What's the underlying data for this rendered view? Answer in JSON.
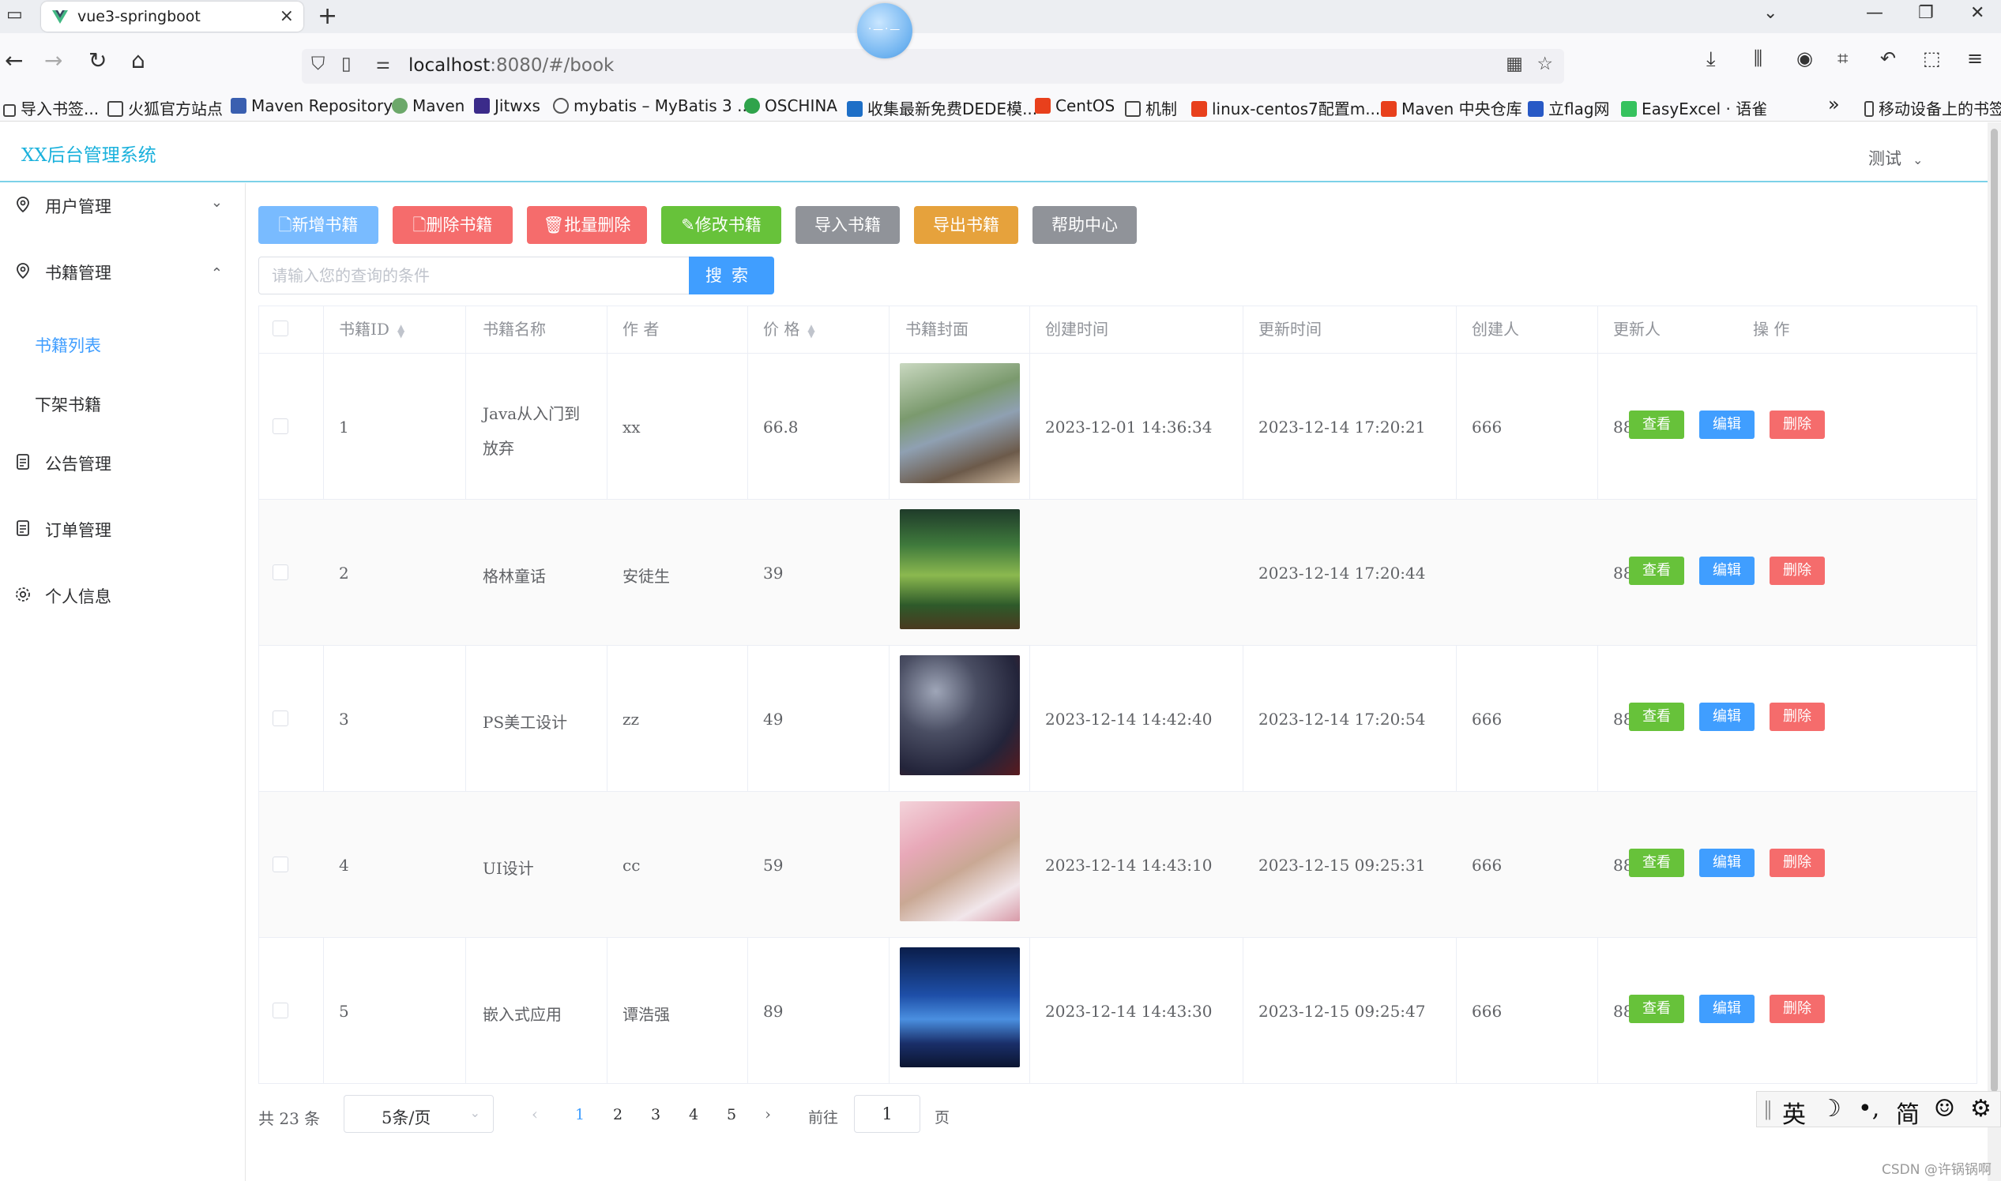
{
  "browser": {
    "tab_title": "vue3-springboot",
    "url_host": "localhost",
    "url_rest": ":8080/#/book",
    "bookmarks": [
      "导入书签...",
      "火狐官方站点",
      "Maven Repository",
      "Maven",
      "Jitwxs",
      "mybatis – MyBatis 3 ...",
      "OSCHINA",
      "收集最新免费DEDE模...",
      "CentOS",
      "机制",
      "linux-centos7配置m...",
      "Maven 中央仓库",
      "立flag网",
      "EasyExcel · 语雀"
    ],
    "bookmarks_overflow": "»",
    "mobile_bookmarks": "移动设备上的书签"
  },
  "app": {
    "brand": "XX后台管理系统",
    "user_menu": "测试",
    "sidebar": {
      "user_mgmt": "用户管理",
      "book_mgmt": "书籍管理",
      "book_list": "书籍列表",
      "book_offshelf": "下架书籍",
      "notice_mgmt": "公告管理",
      "order_mgmt": "订单管理",
      "profile": "个人信息"
    },
    "toolbar": {
      "add": "新增书籍",
      "delete": "删除书籍",
      "batch_delete": "批量删除",
      "edit": "修改书籍",
      "import": "导入书籍",
      "export": "导出书籍",
      "help": "帮助中心"
    },
    "search": {
      "placeholder": "请输入您的查询的条件",
      "button": "搜索"
    },
    "table": {
      "headers": {
        "id": "书籍ID",
        "name": "书籍名称",
        "author": "作 者",
        "price": "价 格",
        "cover": "书籍封面",
        "created": "创建时间",
        "updated": "更新时间",
        "creator": "创建人",
        "updater": "更新人",
        "ops": "操 作"
      },
      "rows": [
        {
          "id": "1",
          "name_line1": "Java从入门到",
          "name_line2": "放弃",
          "author": "xx",
          "price": "66.8",
          "created": "2023-12-01 14:36:34",
          "updated": "2023-12-14 17:20:21",
          "creator": "666",
          "updater": "888"
        },
        {
          "id": "2",
          "name_line1": "格林童话",
          "name_line2": "",
          "author": "安徒生",
          "price": "39",
          "created": "",
          "updated": "2023-12-14 17:20:44",
          "creator": "",
          "updater": "888"
        },
        {
          "id": "3",
          "name_line1": "PS美工设计",
          "name_line2": "",
          "author": "zz",
          "price": "49",
          "created": "2023-12-14 14:42:40",
          "updated": "2023-12-14 17:20:54",
          "creator": "666",
          "updater": "888"
        },
        {
          "id": "4",
          "name_line1": "UI设计",
          "name_line2": "",
          "author": "cc",
          "price": "59",
          "created": "2023-12-14 14:43:10",
          "updated": "2023-12-15 09:25:31",
          "creator": "666",
          "updater": "888"
        },
        {
          "id": "5",
          "name_line1": "嵌入式应用",
          "name_line2": "",
          "author": "谭浩强",
          "price": "89",
          "created": "2023-12-14 14:43:30",
          "updated": "2023-12-15 09:25:47",
          "creator": "666",
          "updater": "888"
        }
      ],
      "op_view": "查看",
      "op_edit": "编辑",
      "op_delete": "删除"
    },
    "pagination": {
      "total": "共 23 条",
      "page_size": "5条/页",
      "pages": [
        "1",
        "2",
        "3",
        "4",
        "5"
      ],
      "current": "1",
      "goto_prefix": "前往",
      "goto_value": "1",
      "goto_suffix": "页"
    }
  },
  "ime": {
    "lang": "英",
    "moon": "☽",
    "punct": "•,",
    "simp": "简",
    "emoji": "☺",
    "settings": "⚙"
  },
  "watermark": "CSDN @许锅锅啊",
  "colors": {
    "primary": "#409eff",
    "success": "#67c23a",
    "danger": "#f56c6c",
    "info": "#909399",
    "warning": "#e6a23c",
    "brand": "#1ab1dc"
  }
}
